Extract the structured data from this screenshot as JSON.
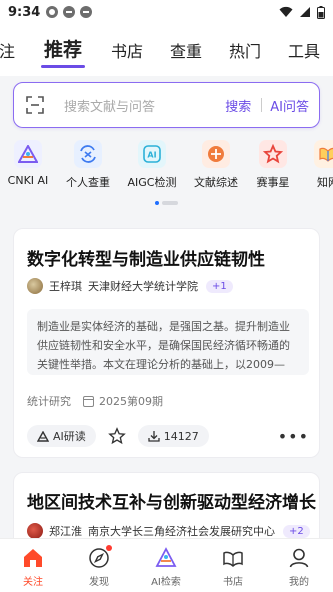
{
  "status_bar": {
    "time": "9:34"
  },
  "top_tabs": [
    "注",
    "推荐",
    "书店",
    "查重",
    "热门",
    "工具"
  ],
  "search": {
    "placeholder": "搜索文献与问答",
    "search_label": "搜索",
    "ai_label": "AI问答"
  },
  "quick_items": [
    {
      "label": "CNKI AI",
      "icon": "cnki-ai-icon"
    },
    {
      "label": "个人查重",
      "icon": "plagiarism-check-icon"
    },
    {
      "label": "AIGC检测",
      "icon": "aigc-detect-icon"
    },
    {
      "label": "文献综述",
      "icon": "literature-review-icon"
    },
    {
      "label": "赛事星",
      "icon": "contest-star-icon"
    },
    {
      "label": "知网",
      "icon": "cnki-book-icon"
    }
  ],
  "cards": [
    {
      "title": "数字化转型与制造业供应链韧性",
      "author": "王梓琪",
      "affiliation": "天津财经大学统计学院",
      "more_authors": "+1",
      "abstract": "制造业是实体经济的基础，是强国之基。提升制造业供应链韧性和安全水平，是确保国民经济循环畅通的关键性举措。本文在理论分析的基础上，以2009—",
      "source": "统计研究",
      "issue": "2025第09期",
      "ai_read_label": "AI研读",
      "downloads": "14127"
    },
    {
      "title": "地区间技术互补与创新驱动型经济增长",
      "author": "郑江淮",
      "affiliation": "南京大学长三角经济社会发展研究中心",
      "more_authors": "+2"
    }
  ],
  "bottom_nav": [
    "关注",
    "发现",
    "AI检索",
    "书店",
    "我的"
  ],
  "colors": {
    "accent": "#6b4ce6",
    "active_nav": "#ff4a2a",
    "pager_dot": "#1e6fff"
  }
}
